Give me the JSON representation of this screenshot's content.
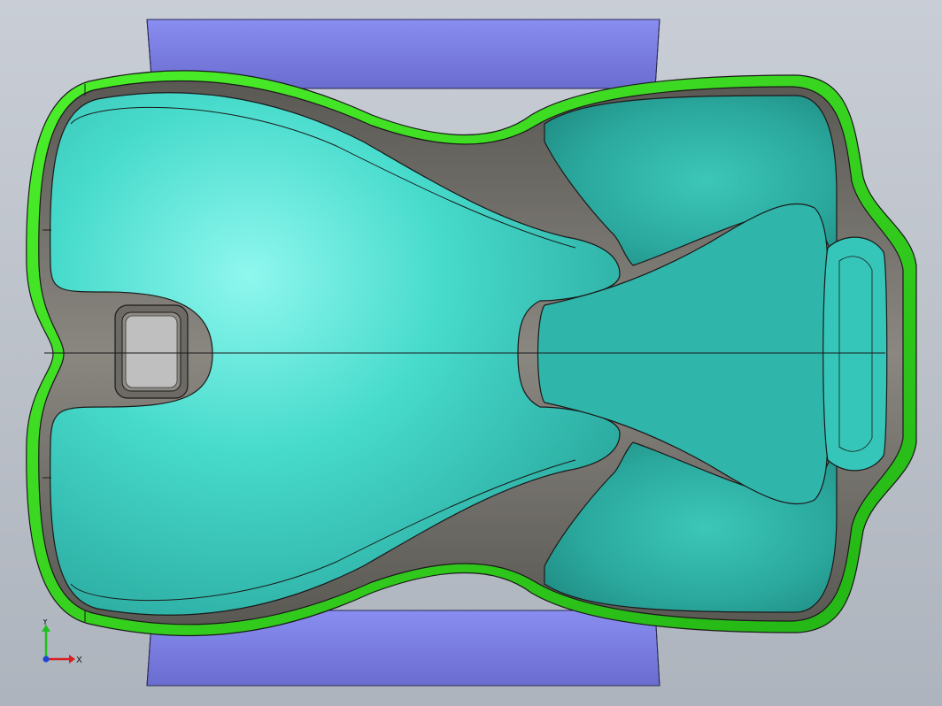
{
  "viewport": {
    "background_top": "#c9ced6",
    "background_bottom": "#aeb4bd",
    "colors": {
      "base_plate": "#7f83e6",
      "base_plate_dark": "#5e61c4",
      "flange": "#3fe01e",
      "flange_dark": "#1e9a12",
      "gray_wall": "#6f6c67",
      "seat_surface": "#3fd1c3",
      "seat_highlight": "#8ff7ee",
      "seat_shadow": "#1e8f86",
      "edge_line": "#1a1a1a"
    }
  },
  "triad": {
    "x_label": "X",
    "y_label": "Y",
    "x_color": "#d61e1e",
    "y_color": "#1ec01e",
    "z_color": "#1e46d6"
  }
}
